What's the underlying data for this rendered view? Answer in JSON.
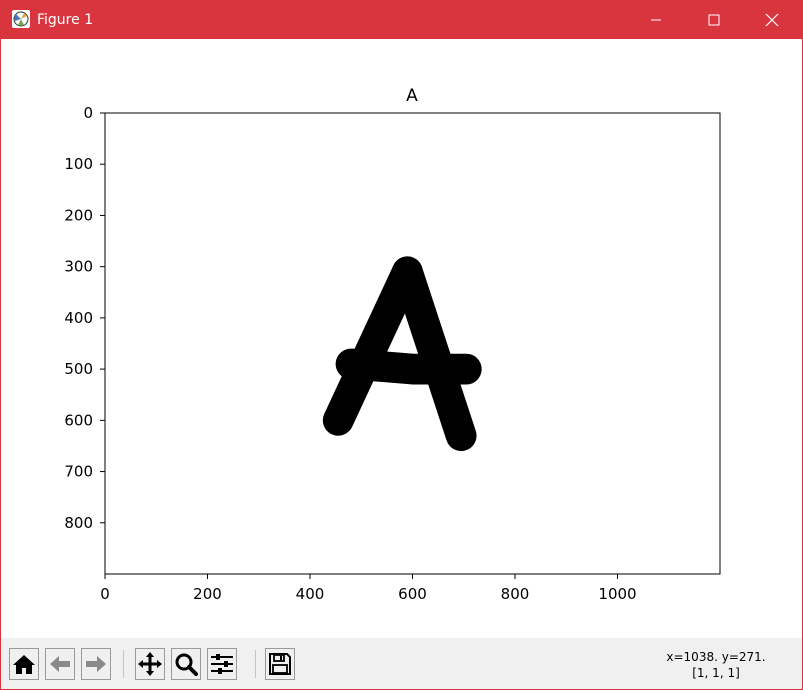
{
  "window": {
    "title": "Figure 1",
    "titlebar_color": "#d9353f"
  },
  "figure": {
    "title": "A",
    "x_ticks": [
      "0",
      "200",
      "400",
      "600",
      "800",
      "1000"
    ],
    "y_ticks": [
      "0",
      "100",
      "200",
      "300",
      "400",
      "500",
      "600",
      "700",
      "800"
    ],
    "image_extent": {
      "width": 1200,
      "height": 900
    }
  },
  "stroke": {
    "color": "#000000",
    "segments": [
      {
        "points": [
          [
            455,
            600
          ],
          [
            590,
            310
          ]
        ]
      },
      {
        "points": [
          [
            590,
            310
          ],
          [
            695,
            630
          ]
        ]
      },
      {
        "points": [
          [
            480,
            490
          ],
          [
            540,
            495
          ],
          [
            600,
            500
          ],
          [
            705,
            500
          ]
        ]
      }
    ],
    "stroke_width_data": 60
  },
  "toolbar": {
    "icons": [
      "home-icon",
      "back-arrow-icon",
      "forward-arrow-icon",
      "pan-icon",
      "zoom-icon",
      "configure-subplots-icon",
      "save-icon"
    ]
  },
  "status": {
    "coords": "x=1038. y=271.",
    "value": "[1, 1, 1]"
  }
}
